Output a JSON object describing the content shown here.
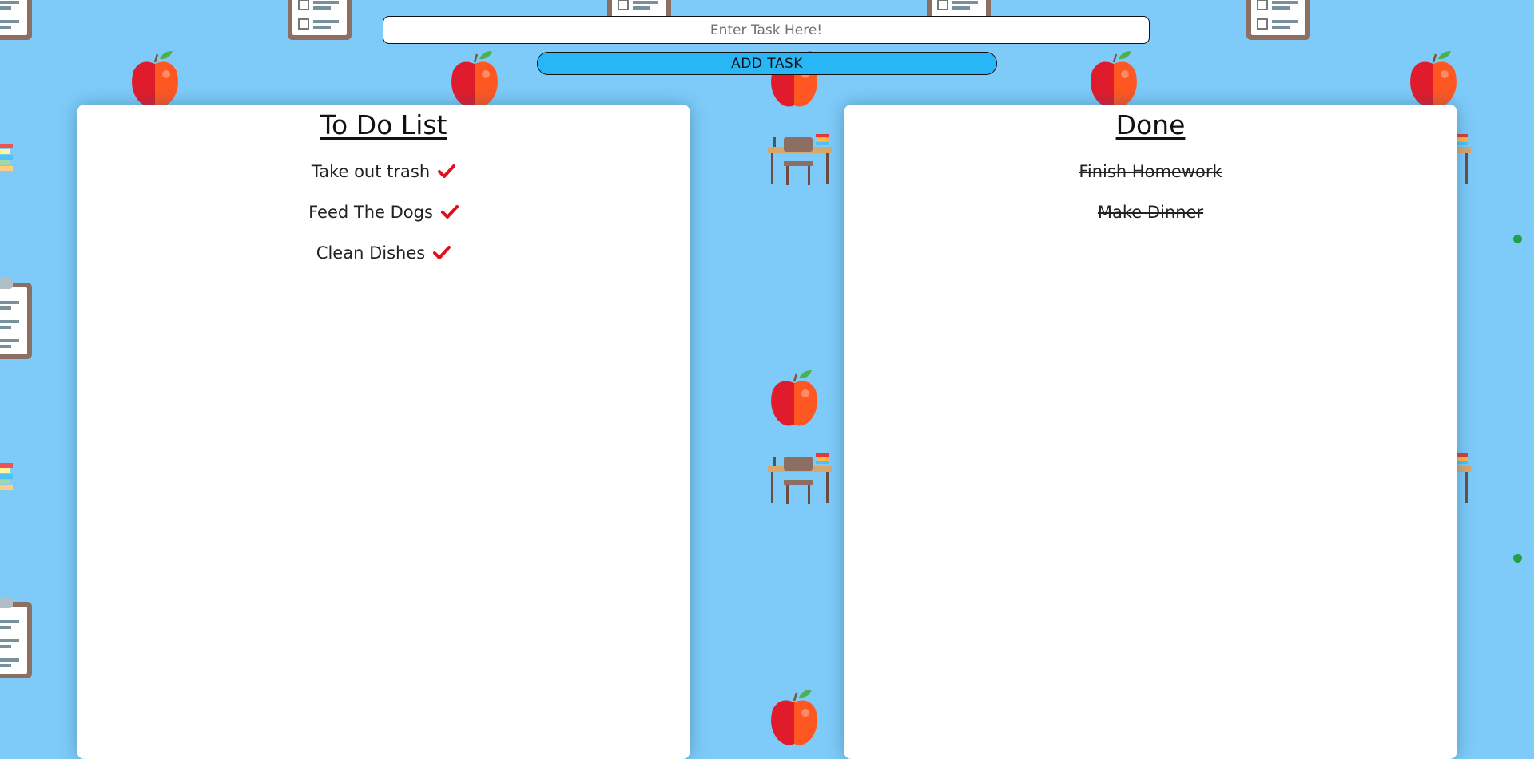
{
  "header": {
    "task_input": {
      "value": "",
      "placeholder": "Enter Task Here!"
    },
    "add_button_label": "ADD TASK"
  },
  "todo": {
    "title": "To Do List",
    "items": [
      {
        "label": "Take out trash"
      },
      {
        "label": "Feed The Dogs"
      },
      {
        "label": "Clean Dishes"
      }
    ]
  },
  "done": {
    "title": "Done",
    "items": [
      {
        "label": "Finish Homework"
      },
      {
        "label": "Make Dinner"
      }
    ]
  },
  "icons": {
    "check": "check-icon",
    "background": [
      "apple-icon",
      "clipboard-icon",
      "desk-icon",
      "books-icon"
    ]
  },
  "colors": {
    "background": "#7ecbf9",
    "button": "#29b6f6",
    "check": "#e0101b",
    "status_dot": "#21a045",
    "panel": "#ffffff"
  }
}
